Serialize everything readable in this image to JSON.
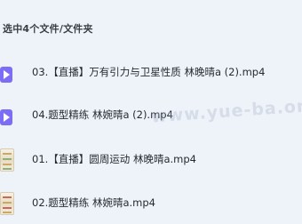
{
  "selection": {
    "summary": "选中4个文件/文件夹"
  },
  "files": [
    {
      "name": "03.【直播】万有引力与卫星性质 林晚晴a (2).mp4",
      "icon": "video-file-icon"
    },
    {
      "name": "04.题型精练 林婉晴a (2).mp4",
      "icon": "video-file-icon"
    },
    {
      "name": "01.【直播】圆周运动 林晚晴a.mp4",
      "icon": "video-thumbnail-icon"
    },
    {
      "name": "02.题型精练 林婉晴a.mp4",
      "icon": "video-thumbnail-icon"
    }
  ],
  "watermark": {
    "text": "www.yue-ba.org"
  },
  "colors": {
    "background": "#eef3f9",
    "video_icon": "#7b6df5"
  }
}
